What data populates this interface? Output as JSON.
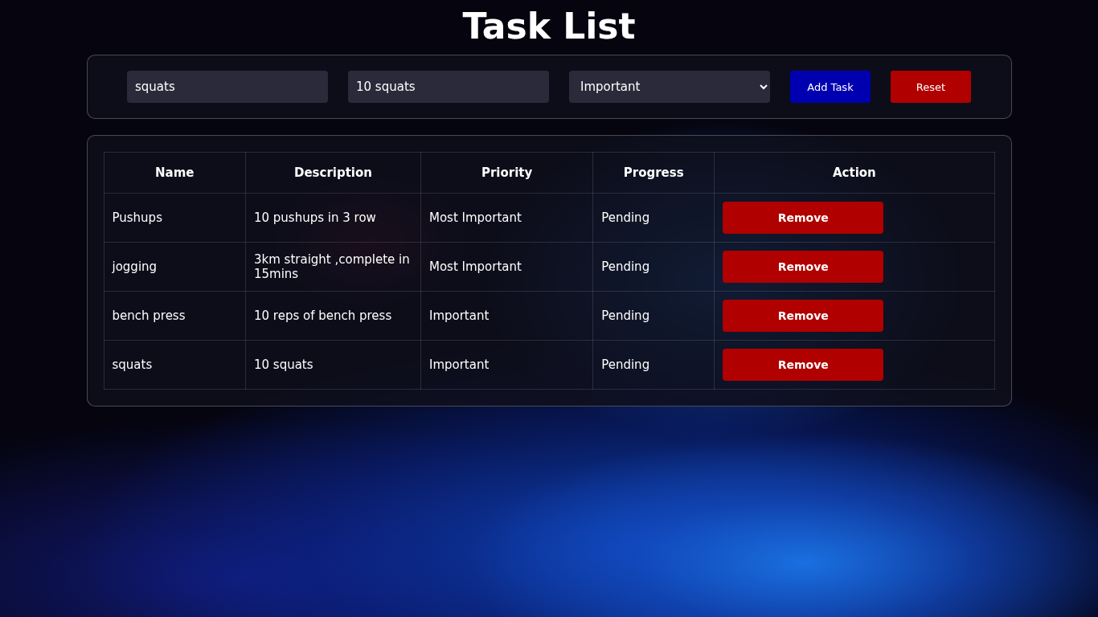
{
  "title": "Task List",
  "form": {
    "name_value": "squats",
    "description_value": "10 squats",
    "priority_value": "Important",
    "buttons": [
      {
        "label": "Add Task",
        "kind": "primary"
      },
      {
        "label": "Reset",
        "kind": "danger"
      }
    ]
  },
  "table": {
    "columns": [
      "Name",
      "Description",
      "Priority",
      "Progress",
      "Action"
    ],
    "rows": [
      {
        "name": "Pushups",
        "description": "10 pushups in 3 row",
        "priority": "Most Important",
        "progress": "Pending",
        "action": "Remove"
      },
      {
        "name": "jogging",
        "description": "3km straight ,complete in 15mins",
        "priority": "Most Important",
        "progress": "Pending",
        "action": "Remove"
      },
      {
        "name": "bench press",
        "description": "10 reps of bench press",
        "priority": "Important",
        "progress": "Pending",
        "action": "Remove"
      },
      {
        "name": "squats",
        "description": "10 squats",
        "priority": "Important",
        "progress": "Pending",
        "action": "Remove"
      }
    ]
  }
}
